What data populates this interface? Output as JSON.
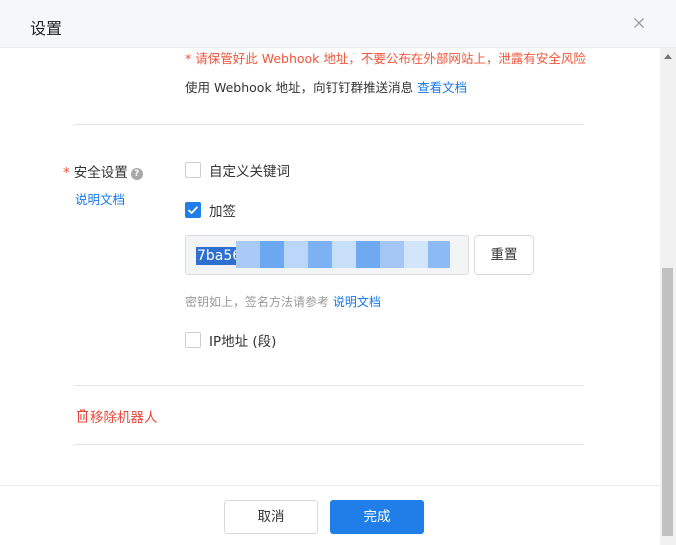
{
  "dialog": {
    "title": "设置",
    "close_icon": "close-icon"
  },
  "webhook": {
    "warning": "* 请保管好此 Webhook 地址，不要公布在外部网站上，泄露有安全风险",
    "usage_text": "使用 Webhook 地址，向钉钉群推送消息 ",
    "usage_link": "查看文档"
  },
  "security": {
    "label": "安全设置",
    "required_mark": "*",
    "help_icon": "question-circle-icon",
    "doc_link": "说明文档",
    "options": [
      {
        "label": "自定义关键词",
        "checked": false
      },
      {
        "label": "加签",
        "checked": true
      },
      {
        "label": "IP地址 (段)",
        "checked": false
      }
    ],
    "secret_value": "7ba56",
    "reset_label": "重置",
    "hint_text": "密钥如上，签名方法请参考 ",
    "hint_link": "说明文档"
  },
  "remove": {
    "label": "移除机器人",
    "icon": "trash-icon"
  },
  "footer": {
    "cancel_label": "取消",
    "confirm_label": "完成"
  },
  "colors": {
    "primary": "#1f7ee8",
    "danger": "#f0553b"
  }
}
